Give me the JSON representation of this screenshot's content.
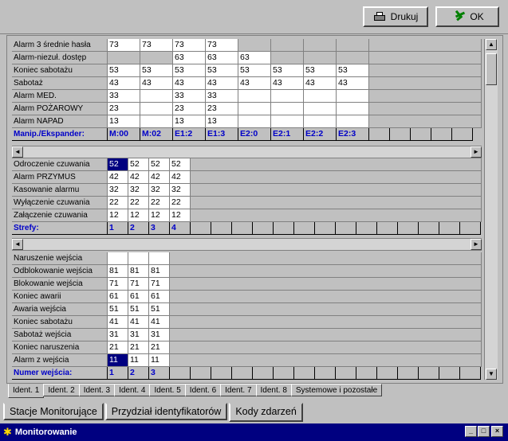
{
  "toolbar": {
    "print_label": "Drukuj",
    "ok_label": "OK"
  },
  "grid1": {
    "rows": [
      {
        "label": "Alarm 3 średnie hasła",
        "values": [
          "73",
          "73",
          "73",
          "73",
          "",
          "",
          "",
          ""
        ]
      },
      {
        "label": "Alarm-niezuł. dostęp",
        "values": [
          "",
          "",
          "63",
          "63",
          "63",
          "",
          "",
          ""
        ]
      },
      {
        "label": "Koniec sabotażu",
        "values": [
          "53",
          "53",
          "53",
          "53",
          "53",
          "53",
          "53",
          "53"
        ]
      },
      {
        "label": "Sabotaż",
        "values": [
          "43",
          "43",
          "43",
          "43",
          "43",
          "43",
          "43",
          "43"
        ]
      },
      {
        "label": "Alarm MED.",
        "values": [
          "33",
          "",
          "33",
          "33",
          "",
          "",
          "",
          ""
        ]
      },
      {
        "label": "Alarm POŻAROWY",
        "values": [
          "23",
          "",
          "23",
          "23",
          "",
          "",
          "",
          ""
        ]
      },
      {
        "label": "Alarm NAPAD",
        "values": [
          "13",
          "",
          "13",
          "13",
          "",
          "",
          "",
          ""
        ]
      }
    ],
    "header": {
      "label": "Manip./Ekspander:",
      "cols": [
        "M:00",
        "M:02",
        "E1:2",
        "E1:3",
        "E2:0",
        "E2:1",
        "E2:2",
        "E2:3"
      ]
    }
  },
  "grid2": {
    "rows": [
      {
        "label": "Odroczenie czuwania",
        "values": [
          "52",
          "52",
          "52",
          "52"
        ]
      },
      {
        "label": "Alarm PRZYMUS",
        "values": [
          "42",
          "42",
          "42",
          "42"
        ]
      },
      {
        "label": "Kasowanie alarmu",
        "values": [
          "32",
          "32",
          "32",
          "32"
        ]
      },
      {
        "label": "Wyłączenie czuwania",
        "values": [
          "22",
          "22",
          "22",
          "22"
        ]
      },
      {
        "label": "Załączenie czuwania",
        "values": [
          "12",
          "12",
          "12",
          "12"
        ]
      }
    ],
    "header": {
      "label": "Strefy:",
      "cols": [
        "1",
        "2",
        "3",
        "4"
      ]
    }
  },
  "grid3": {
    "rows": [
      {
        "label": "Naruszenie wejścia",
        "values": [
          "",
          "",
          ""
        ]
      },
      {
        "label": "Odblokowanie wejścia",
        "values": [
          "81",
          "81",
          "81"
        ]
      },
      {
        "label": "Blokowanie wejścia",
        "values": [
          "71",
          "71",
          "71"
        ]
      },
      {
        "label": "Koniec awarii",
        "values": [
          "61",
          "61",
          "61"
        ]
      },
      {
        "label": "Awaria wejścia",
        "values": [
          "51",
          "51",
          "51"
        ]
      },
      {
        "label": "Koniec sabotażu",
        "values": [
          "41",
          "41",
          "41"
        ]
      },
      {
        "label": "Sabotaż wejścia",
        "values": [
          "31",
          "31",
          "31"
        ]
      },
      {
        "label": "Koniec naruszenia",
        "values": [
          "21",
          "21",
          "21"
        ]
      },
      {
        "label": "Alarm z wejścia",
        "values": [
          "11",
          "11",
          "11"
        ]
      }
    ],
    "header": {
      "label": "Numer wejścia:",
      "cols": [
        "1",
        "2",
        "3"
      ]
    }
  },
  "page_tabs": [
    "Ident. 1",
    "Ident. 2",
    "Ident. 3",
    "Ident. 4",
    "Ident. 5",
    "Ident. 6",
    "Ident. 7",
    "Ident. 8",
    "Systemowe i pozostałe"
  ],
  "main_tabs": [
    "Stacje Monitorujące",
    "Przydział identyfikatorów",
    "Kody zdarzeń"
  ],
  "window": {
    "title": "Monitorowanie"
  }
}
